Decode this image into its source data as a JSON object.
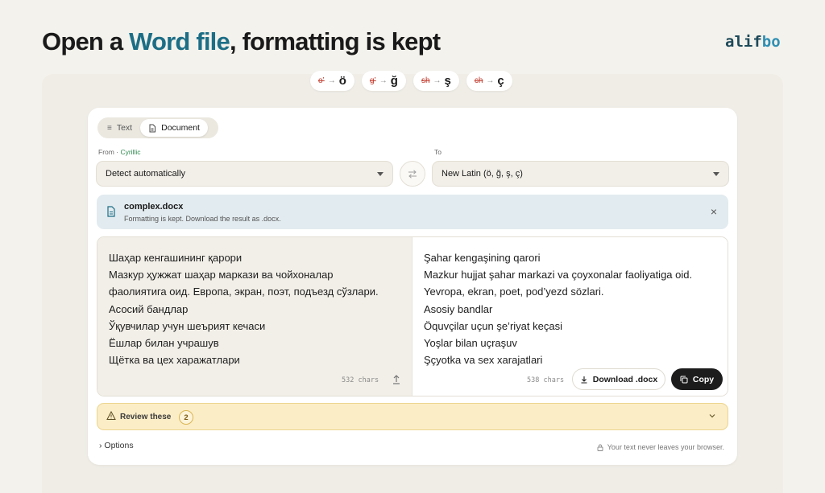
{
  "headline": {
    "part1": "Open a ",
    "highlight": "Word file",
    "part2": ", formatting is kept"
  },
  "logo": {
    "part1": "alif",
    "part2": "bo"
  },
  "pills": [
    {
      "old": "o’",
      "arrow": "→",
      "new": "ö"
    },
    {
      "old": "g’",
      "arrow": "→",
      "new": "ğ"
    },
    {
      "old": "sh",
      "arrow": "→",
      "new": "ş"
    },
    {
      "old": "ch",
      "arrow": "→",
      "new": "ç"
    }
  ],
  "tabs": {
    "text": "Text",
    "document": "Document",
    "active": "document"
  },
  "from": {
    "label": "From",
    "sep": "·",
    "detected": "Cyrillic",
    "value": "Detect automatically"
  },
  "to": {
    "label": "To",
    "value": "New Latin (ö, ğ, ş, ç)"
  },
  "swap_icon": "swap-arrows-icon",
  "file": {
    "name": "complex.docx",
    "subtitle": "Formatting is kept. Download the result as .docx.",
    "close": "×"
  },
  "source": {
    "lines": [
      "Шаҳар кенгашининг қарори",
      "Мазкур ҳужжат шаҳар маркази ва чойхоналар",
      "фаолиятига оид. Европа, экран, поэт, подъезд сўзлари.",
      "Асосий бандлар",
      "Ўқувчилар учун шеърият кечаси",
      "Ёшлар билан учрашув",
      "Щётка ва цех харажатлари"
    ],
    "chars": "532 chars"
  },
  "result": {
    "lines": [
      "Şahar kengaşining qarori",
      "Mazkur hujjat şahar markazi va çoyxonalar faoliyatiga oid.",
      "Yevropa, ekran, poet, pod’yezd sözlari.",
      "Asosiy bandlar",
      "Öquvçilar uçun şe’riyat keçasi",
      "Yoşlar bilan uçraşuv",
      "Şçyotka va sex xarajatlari"
    ],
    "chars": "538 chars",
    "download_label": "Download .docx",
    "copy_label": "Copy"
  },
  "review": {
    "label": "Review these",
    "count": "2"
  },
  "options": {
    "label": "Options",
    "chevron": "›"
  },
  "privacy": "Your text never leaves your browser.",
  "colors": {
    "accent": "#1c6e86",
    "warning_bg": "#fbedc6",
    "file_bg": "#e2ebef",
    "dark_button": "#1c1c1c"
  }
}
